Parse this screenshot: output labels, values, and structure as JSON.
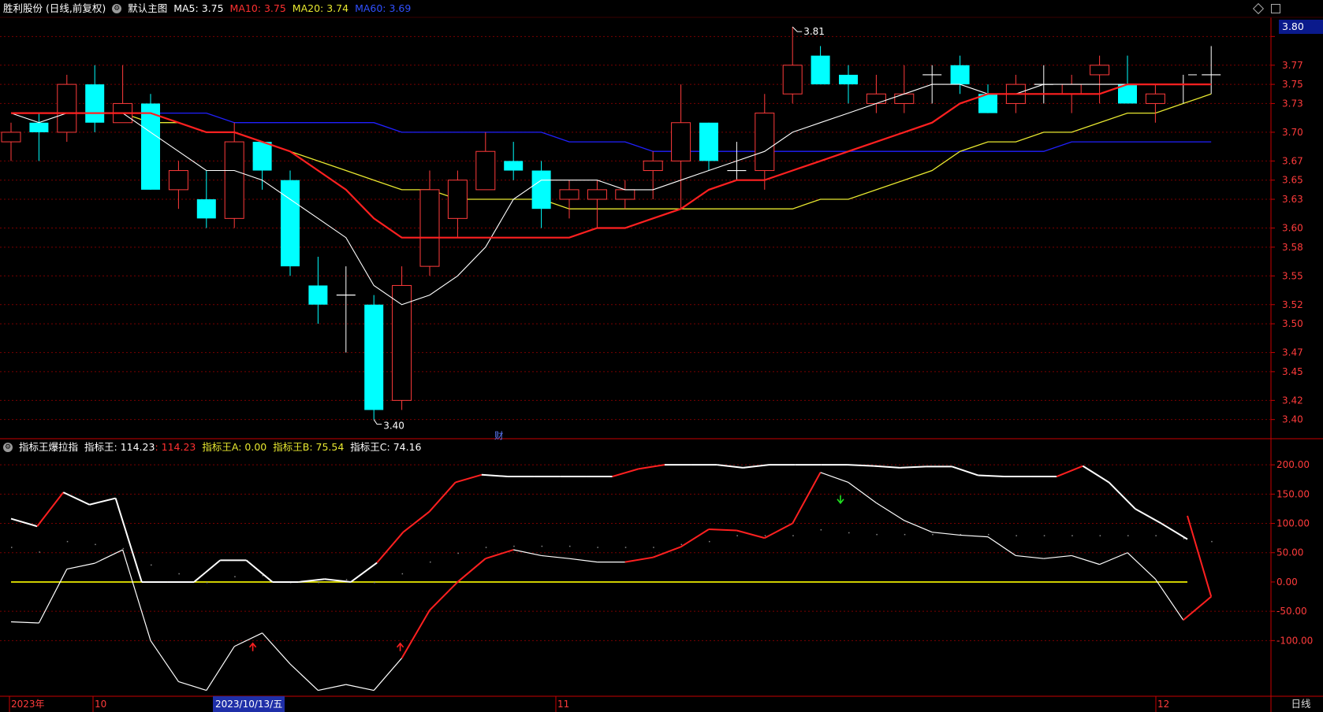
{
  "header_top": {
    "title": "胜利股份 (日线,前复权)",
    "template": "默认主图",
    "ma5_label": "MA5: 3.75",
    "ma10_label": "MA10: 3.75",
    "ma20_label": "MA20: 3.74",
    "ma60_label": "MA60: 3.69"
  },
  "header_bottom": {
    "title": "指标王爆拉指",
    "zbw_label": "指标王: 114.23",
    "zbw_value2": ": 114.23",
    "a_label": "指标王A: 0.00",
    "b_label": "指标王B: 75.54",
    "c_label": "指标王C: 74.16"
  },
  "current_price": "3.80",
  "period_label": "日线",
  "finance_marker": "财",
  "high_label": "3.81",
  "low_label": "3.40",
  "x_labels": [
    {
      "text": "2023年",
      "color": "#ff3b3b"
    },
    {
      "text": "10",
      "color": "#ff3b3b"
    },
    {
      "text": "2023/10/13/五",
      "color": "#ffffff",
      "highlight": true
    },
    {
      "text": "11",
      "color": "#ff3b3b"
    },
    {
      "text": "12",
      "color": "#ff3b3b"
    }
  ],
  "colors": {
    "up": "#ff3b3b",
    "down": "#00ffff",
    "ma5": "#ffffff",
    "ma10": "#ff2020",
    "ma20": "#e8e830",
    "ma60": "#2020ff",
    "grid": "#7a0000",
    "axis": "#c80000",
    "zero": "#ffff00"
  },
  "chart_data": {
    "type": "candlestick",
    "y_ticks": [
      "3.80",
      "3.77",
      "3.75",
      "3.73",
      "3.70",
      "3.67",
      "3.65",
      "3.63",
      "3.60",
      "3.58",
      "3.55",
      "3.52",
      "3.50",
      "3.47",
      "3.45",
      "3.42",
      "3.40"
    ],
    "ylim": [
      3.38,
      3.82
    ],
    "candles": [
      {
        "o": 3.69,
        "c": 3.7,
        "h": 3.71,
        "l": 3.67
      },
      {
        "o": 3.71,
        "c": 3.7,
        "h": 3.72,
        "l": 3.67
      },
      {
        "o": 3.7,
        "c": 3.75,
        "h": 3.76,
        "l": 3.69
      },
      {
        "o": 3.75,
        "c": 3.71,
        "h": 3.77,
        "l": 3.7
      },
      {
        "o": 3.71,
        "c": 3.73,
        "h": 3.77,
        "l": 3.71
      },
      {
        "o": 3.73,
        "c": 3.64,
        "h": 3.74,
        "l": 3.64
      },
      {
        "o": 3.64,
        "c": 3.66,
        "h": 3.67,
        "l": 3.62
      },
      {
        "o": 3.63,
        "c": 3.61,
        "h": 3.66,
        "l": 3.6
      },
      {
        "o": 3.61,
        "c": 3.69,
        "h": 3.71,
        "l": 3.6
      },
      {
        "o": 3.69,
        "c": 3.66,
        "h": 3.69,
        "l": 3.64
      },
      {
        "o": 3.65,
        "c": 3.56,
        "h": 3.66,
        "l": 3.55
      },
      {
        "o": 3.54,
        "c": 3.52,
        "h": 3.57,
        "l": 3.5
      },
      {
        "o": 3.53,
        "c": 3.53,
        "h": 3.56,
        "l": 3.47
      },
      {
        "o": 3.52,
        "c": 3.41,
        "h": 3.53,
        "l": 3.4
      },
      {
        "o": 3.42,
        "c": 3.54,
        "h": 3.56,
        "l": 3.41
      },
      {
        "o": 3.56,
        "c": 3.64,
        "h": 3.66,
        "l": 3.55
      },
      {
        "o": 3.61,
        "c": 3.65,
        "h": 3.66,
        "l": 3.59
      },
      {
        "o": 3.64,
        "c": 3.68,
        "h": 3.7,
        "l": 3.64
      },
      {
        "o": 3.67,
        "c": 3.66,
        "h": 3.69,
        "l": 3.65
      },
      {
        "o": 3.66,
        "c": 3.62,
        "h": 3.67,
        "l": 3.6
      },
      {
        "o": 3.63,
        "c": 3.64,
        "h": 3.65,
        "l": 3.61
      },
      {
        "o": 3.63,
        "c": 3.64,
        "h": 3.65,
        "l": 3.6
      },
      {
        "o": 3.63,
        "c": 3.64,
        "h": 3.65,
        "l": 3.62
      },
      {
        "o": 3.66,
        "c": 3.67,
        "h": 3.68,
        "l": 3.63
      },
      {
        "o": 3.67,
        "c": 3.71,
        "h": 3.75,
        "l": 3.62
      },
      {
        "o": 3.71,
        "c": 3.67,
        "h": 3.71,
        "l": 3.66
      },
      {
        "o": 3.66,
        "c": 3.66,
        "h": 3.69,
        "l": 3.65
      },
      {
        "o": 3.66,
        "c": 3.72,
        "h": 3.74,
        "l": 3.64
      },
      {
        "o": 3.74,
        "c": 3.77,
        "h": 3.81,
        "l": 3.73
      },
      {
        "o": 3.78,
        "c": 3.75,
        "h": 3.79,
        "l": 3.75
      },
      {
        "o": 3.76,
        "c": 3.75,
        "h": 3.77,
        "l": 3.73
      },
      {
        "o": 3.73,
        "c": 3.74,
        "h": 3.76,
        "l": 3.72
      },
      {
        "o": 3.73,
        "c": 3.74,
        "h": 3.77,
        "l": 3.72
      },
      {
        "o": 3.76,
        "c": 3.76,
        "h": 3.77,
        "l": 3.73
      },
      {
        "o": 3.77,
        "c": 3.75,
        "h": 3.78,
        "l": 3.74
      },
      {
        "o": 3.74,
        "c": 3.72,
        "h": 3.75,
        "l": 3.72
      },
      {
        "o": 3.73,
        "c": 3.75,
        "h": 3.76,
        "l": 3.72
      },
      {
        "o": 3.75,
        "c": 3.75,
        "h": 3.77,
        "l": 3.73
      },
      {
        "o": 3.74,
        "c": 3.75,
        "h": 3.76,
        "l": 3.72
      },
      {
        "o": 3.76,
        "c": 3.77,
        "h": 3.78,
        "l": 3.73
      },
      {
        "o": 3.75,
        "c": 3.73,
        "h": 3.78,
        "l": 3.73
      },
      {
        "o": 3.73,
        "c": 3.74,
        "h": 3.75,
        "l": 3.71
      },
      {
        "o": 3.75,
        "c": 3.75,
        "h": 3.76,
        "l": 3.73
      },
      {
        "o": 3.76,
        "c": 3.76,
        "h": 3.79,
        "l": 3.74
      }
    ],
    "ma5": [
      3.72,
      3.71,
      3.72,
      3.72,
      3.72,
      3.7,
      3.68,
      3.66,
      3.66,
      3.65,
      3.63,
      3.61,
      3.59,
      3.54,
      3.52,
      3.53,
      3.55,
      3.58,
      3.63,
      3.65,
      3.65,
      3.65,
      3.64,
      3.64,
      3.65,
      3.66,
      3.67,
      3.68,
      3.7,
      3.71,
      3.72,
      3.73,
      3.74,
      3.75,
      3.75,
      3.74,
      3.74,
      3.75,
      3.75,
      3.75,
      3.75,
      3.75,
      3.75,
      3.75
    ],
    "ma10": [
      3.72,
      3.72,
      3.72,
      3.72,
      3.72,
      3.72,
      3.71,
      3.7,
      3.7,
      3.69,
      3.68,
      3.66,
      3.64,
      3.61,
      3.59,
      3.59,
      3.59,
      3.59,
      3.59,
      3.59,
      3.59,
      3.6,
      3.6,
      3.61,
      3.62,
      3.64,
      3.65,
      3.65,
      3.66,
      3.67,
      3.68,
      3.69,
      3.7,
      3.71,
      3.73,
      3.74,
      3.74,
      3.74,
      3.74,
      3.74,
      3.75,
      3.75,
      3.75,
      3.75
    ],
    "ma20": [
      3.72,
      3.72,
      3.72,
      3.72,
      3.72,
      3.71,
      3.71,
      3.7,
      3.7,
      3.69,
      3.68,
      3.67,
      3.66,
      3.65,
      3.64,
      3.64,
      3.63,
      3.63,
      3.63,
      3.63,
      3.62,
      3.62,
      3.62,
      3.62,
      3.62,
      3.62,
      3.62,
      3.62,
      3.62,
      3.63,
      3.63,
      3.64,
      3.65,
      3.66,
      3.68,
      3.69,
      3.69,
      3.7,
      3.7,
      3.71,
      3.72,
      3.72,
      3.73,
      3.74
    ],
    "ma60": [
      3.72,
      3.72,
      3.72,
      3.72,
      3.72,
      3.72,
      3.72,
      3.72,
      3.71,
      3.71,
      3.71,
      3.71,
      3.71,
      3.71,
      3.7,
      3.7,
      3.7,
      3.7,
      3.7,
      3.7,
      3.69,
      3.69,
      3.69,
      3.68,
      3.68,
      3.68,
      3.68,
      3.68,
      3.68,
      3.68,
      3.68,
      3.68,
      3.68,
      3.68,
      3.68,
      3.68,
      3.68,
      3.68,
      3.69,
      3.69,
      3.69,
      3.69,
      3.69,
      3.69
    ],
    "indicator": {
      "y_ticks": [
        "200.00",
        "150.00",
        "100.00",
        "50.00",
        "0.00",
        "-50.00",
        "-100.00"
      ],
      "ylim": [
        -195,
        215
      ],
      "line_hi": [
        108,
        95,
        153,
        132,
        143,
        0,
        0,
        0,
        37,
        37,
        0,
        0,
        5,
        0,
        33,
        85,
        120,
        170,
        183,
        180,
        180,
        180,
        180,
        180,
        193,
        200,
        200,
        200,
        195,
        200,
        200,
        200,
        200,
        198,
        195,
        197,
        197,
        182,
        180,
        180,
        180,
        198,
        170,
        125,
        100,
        73
      ],
      "line_hi_tip": 113,
      "line_lo": [
        -68,
        -70,
        22,
        32,
        55,
        -100,
        -170,
        -185,
        -110,
        -87,
        -140,
        -185,
        -175,
        -185,
        -130,
        -48,
        0,
        40,
        55,
        45,
        40,
        34,
        34,
        42,
        60,
        90,
        88,
        75,
        100,
        187,
        170,
        135,
        105,
        85,
        80,
        77,
        45,
        40,
        45,
        30,
        50,
        5,
        -65,
        -25
      ],
      "dots": [
        60,
        52,
        70,
        65,
        58,
        30,
        15,
        0,
        10,
        12,
        0,
        0,
        5,
        0,
        15,
        35,
        50,
        60,
        62,
        62,
        62,
        60,
        60,
        60,
        65,
        70,
        80,
        80,
        80,
        90,
        85,
        82,
        82,
        82,
        82,
        82,
        80,
        80,
        80,
        80,
        80,
        80,
        75,
        70
      ]
    }
  }
}
